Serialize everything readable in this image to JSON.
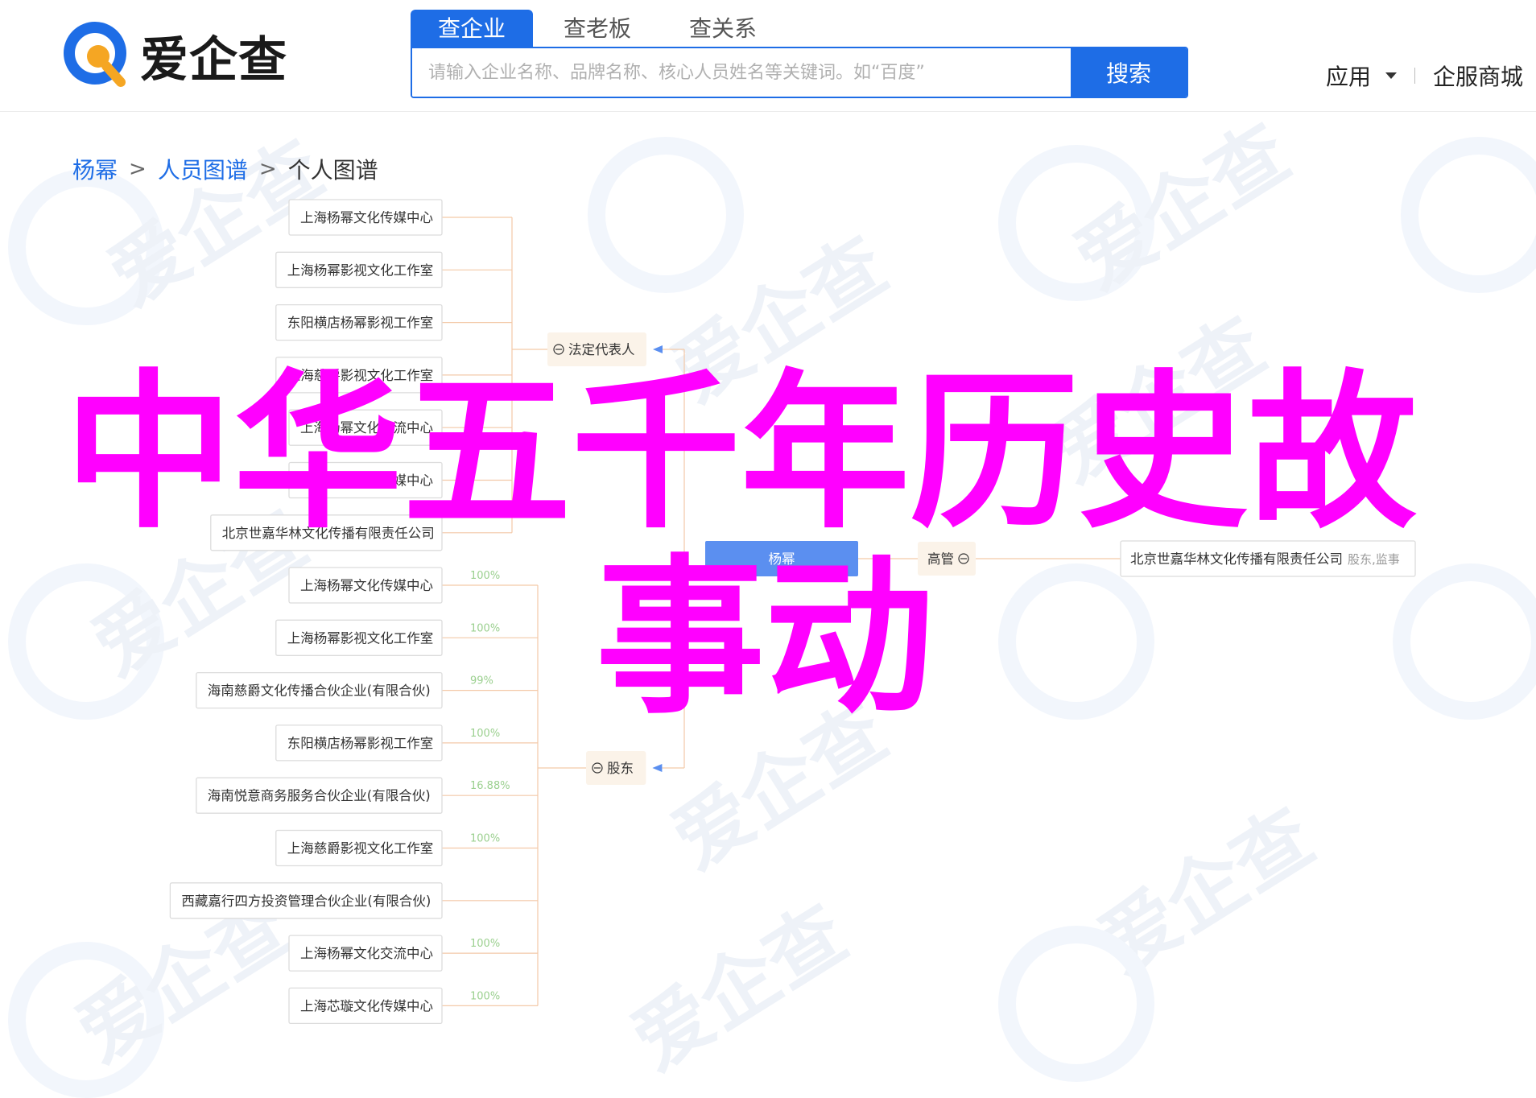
{
  "header": {
    "logo_text": "爱企查",
    "search_tabs": [
      "查企业",
      "查老板",
      "查关系"
    ],
    "search_placeholder": "请输入企业名称、品牌名称、核心人员姓名等关键词。如“百度”",
    "search_button": "搜索",
    "nav_app": "应用",
    "nav_mall": "企服商城"
  },
  "breadcrumb": {
    "items": [
      "杨幂",
      "人员图谱"
    ],
    "current": "个人图谱"
  },
  "graph": {
    "center": "杨幂",
    "manager_label": "高管",
    "manager_company": "北京世嘉华林文化传播有限责任公司",
    "manager_roles": "股东,监事",
    "legal_rep_label": "法定代表人",
    "legal_rep_companies": [
      "上海杨幂文化传媒中心",
      "上海杨幂影视文化工作室",
      "东阳横店杨幂影视工作室",
      "上海慈爵影视文化工作室",
      "上海杨幂文化交流中心",
      "上海芯璇文化传媒中心",
      "北京世嘉华林文化传播有限责任公司"
    ],
    "shareholder_label": "股东",
    "shareholder_companies": [
      {
        "name": "上海杨幂文化传媒中心",
        "pct": "100%"
      },
      {
        "name": "上海杨幂影视文化工作室",
        "pct": "100%"
      },
      {
        "name": "海南慈爵文化传播合伙企业(有限合伙)",
        "pct": "99%"
      },
      {
        "name": "东阳横店杨幂影视工作室",
        "pct": "100%"
      },
      {
        "name": "海南悦意商务服务合伙企业(有限合伙)",
        "pct": "16.88%"
      },
      {
        "name": "上海慈爵影视文化工作室",
        "pct": "100%"
      },
      {
        "name": "西藏嘉行四方投资管理合伙企业(有限合伙)",
        "pct": ""
      },
      {
        "name": "上海杨幂文化交流中心",
        "pct": "100%"
      },
      {
        "name": "上海芯璇文化传媒中心",
        "pct": "100%"
      }
    ]
  },
  "watermark_text": "爱企查",
  "overlay": {
    "line1": "中华五千年历史故",
    "line2": "事动",
    "color": "#ff00ff"
  },
  "colors": {
    "brand_blue": "#1e6de6",
    "logo_orange": "#f5a623",
    "node_border": "#dcdcdc",
    "tree_line": "#f3c9a8",
    "center_fill": "#5b8ff0",
    "percent_green": "#9bd08f"
  }
}
